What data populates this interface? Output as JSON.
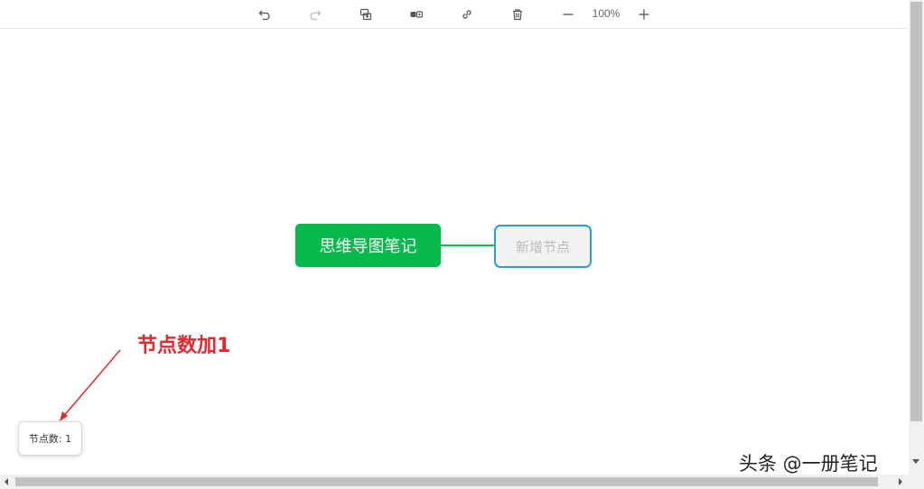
{
  "toolbar": {
    "zoom_label": "100%",
    "icons": [
      "undo-icon",
      "redo-icon",
      "add-child-icon",
      "add-sibling-icon",
      "link-icon",
      "delete-icon",
      "zoom-out-icon",
      "zoom-in-icon"
    ]
  },
  "mindmap": {
    "root_label": "思维导图笔记",
    "child_label": "新增节点",
    "colors": {
      "root_bg": "#07b84a",
      "child_border": "#2b9be0",
      "child_bg": "#f2f2f2"
    }
  },
  "annotation": {
    "text": "节点数加1",
    "color": "#e8262c"
  },
  "status": {
    "node_count_label": "节点数: 1"
  },
  "watermark": "头条 @一册笔记"
}
